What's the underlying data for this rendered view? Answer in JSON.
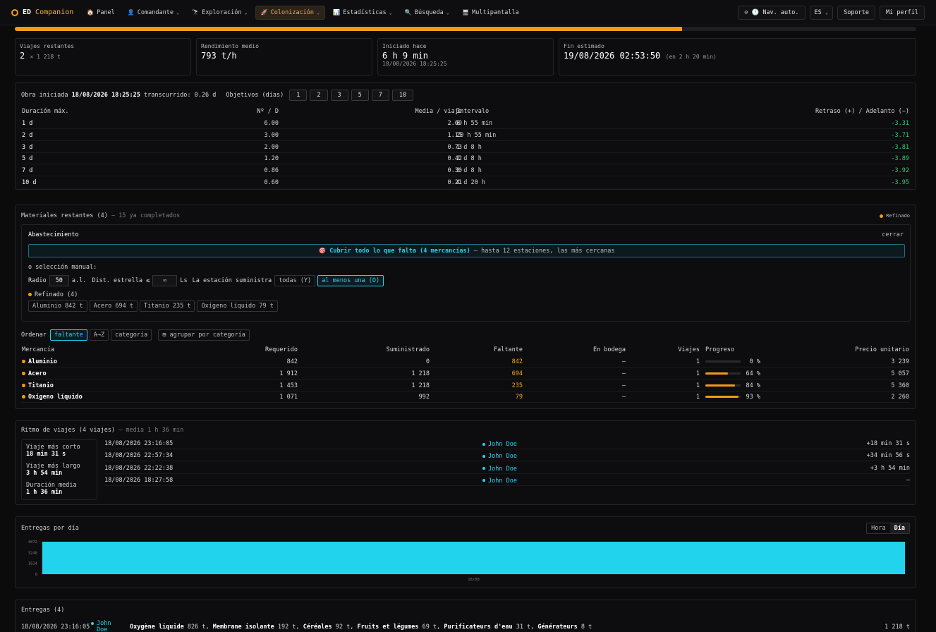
{
  "brand": {
    "a": "ED",
    "b": "Companion"
  },
  "nav": [
    {
      "label": "Panel",
      "icon": "🏠",
      "chev": false
    },
    {
      "label": "Comandante",
      "icon": "👤",
      "chev": true
    },
    {
      "label": "Exploración",
      "icon": "🔭",
      "chev": true
    },
    {
      "label": "Colonización",
      "icon": "🚀",
      "chev": true,
      "active": true
    },
    {
      "label": "Estadísticas",
      "icon": "📊",
      "chev": true
    },
    {
      "label": "Búsqueda",
      "icon": "🔍",
      "chev": true
    },
    {
      "label": "Multipantalla",
      "icon": "🖥",
      "chev": false
    }
  ],
  "topright": {
    "nav_auto": "⊙ 🕐 Nav. auto.",
    "lang": "ES",
    "support": "Soporte",
    "profile": "Mi perfil"
  },
  "progress": 0.74,
  "stats": [
    {
      "label": "Viajes restantes",
      "value": "2",
      "sub": "× 1 218 t"
    },
    {
      "label": "Rendimiento medio",
      "value": "793 t/h",
      "sub": ""
    },
    {
      "label": "Iniciado hace",
      "value": "6 h 9 min",
      "sub": "18/08/2026 18:25:25"
    },
    {
      "label": "Fin estimado",
      "value": "19/08/2026 02:53:50",
      "sub": "(en 2 h 20 min)"
    }
  ],
  "obra": {
    "prefix": "Obra iniciada",
    "date": "18/08/2026 18:25:25",
    "elapsed": "transcurrido: 0.26 d",
    "objectives_label": "Objetivos (días)",
    "objectives": [
      "1",
      "2",
      "3",
      "5",
      "7",
      "10"
    ]
  },
  "duration_table": {
    "headers": [
      "Duración máx.",
      "Nº / D",
      "Media / viaje",
      "Intervalo",
      "Retraso (+) / Adelanto (−)"
    ],
    "rows": [
      [
        "1 d",
        "6.00",
        "2.69",
        "8 h 55 min",
        "-3.31"
      ],
      [
        "2 d",
        "3.00",
        "1.15",
        "20 h 55 min",
        "-3.71"
      ],
      [
        "3 d",
        "2.00",
        "0.73",
        "1 d 8 h",
        "-3.81"
      ],
      [
        "5 d",
        "1.20",
        "0.42",
        "2 d 8 h",
        "-3.89"
      ],
      [
        "7 d",
        "0.86",
        "0.30",
        "3 d 8 h",
        "-3.92"
      ],
      [
        "10 d",
        "0.60",
        "0.21",
        "4 d 20 h",
        "-3.95"
      ]
    ]
  },
  "materials": {
    "title": "Materiales restantes (4)",
    "done": "— 15 ya completados",
    "legend": "Refinado",
    "supply": {
      "title": "Abastecimiento",
      "close": "cerrar",
      "cover_icon": "🎯",
      "cover_main": "Cubrir todo lo que falta (4 mercancías)",
      "cover_rest": "— hasta 12 estaciones, las más cercanas",
      "manual": "o selección manual:",
      "radius_label": "Radio",
      "radius": "50",
      "radius_unit": "a.l.",
      "dist_label": "Dist. estrella ≤",
      "dist": "∞",
      "dist_unit": "Ls",
      "station_label": "La estación suministra",
      "opt_all": "todas (Y)",
      "opt_one": "al menos una (O)",
      "group": "Refinado (4)",
      "chips": [
        "Aluminio 842 t",
        "Acero 694 t",
        "Titanio 235 t",
        "Oxígeno líquido 79 t"
      ]
    },
    "sort_label": "Ordenar",
    "sorts": [
      "faltante",
      "A→Z",
      "categoría"
    ],
    "group_btn": "⊞ agrupar por categoría",
    "headers": [
      "Mercancía",
      "Requerido",
      "Suministrado",
      "Faltante",
      "En bodega",
      "Viajes",
      "Progreso",
      "Precio unitario"
    ],
    "rows": [
      {
        "name": "Aluminio",
        "req": "842",
        "sup": "0",
        "miss": "842",
        "hold": "–",
        "trips": "1",
        "pct": 0,
        "pct_label": "0 %",
        "price": "3 239"
      },
      {
        "name": "Acero",
        "req": "1 912",
        "sup": "1 218",
        "miss": "694",
        "hold": "–",
        "trips": "1",
        "pct": 64,
        "pct_label": "64 %",
        "price": "5 057"
      },
      {
        "name": "Titanio",
        "req": "1 453",
        "sup": "1 218",
        "miss": "235",
        "hold": "–",
        "trips": "1",
        "pct": 84,
        "pct_label": "84 %",
        "price": "5 360"
      },
      {
        "name": "Oxígeno líquido",
        "req": "1 071",
        "sup": "992",
        "miss": "79",
        "hold": "–",
        "trips": "1",
        "pct": 93,
        "pct_label": "93 %",
        "price": "2 260"
      }
    ]
  },
  "rhythm": {
    "title": "Ritmo de viajes (4 viajes)",
    "sub": "— media 1 h 36 min",
    "summary": [
      {
        "label": "Viaje más corto",
        "value": "18 min 31 s"
      },
      {
        "label": "Viaje más largo",
        "value": "3 h 54 min"
      },
      {
        "label": "Duración media",
        "value": "1 h 36 min"
      }
    ],
    "trips": [
      {
        "date": "18/08/2026 23:16:05",
        "user": "John Doe",
        "delta": "+18 min 31 s"
      },
      {
        "date": "18/08/2026 22:57:34",
        "user": "John Doe",
        "delta": "+34 min 56 s"
      },
      {
        "date": "18/08/2026 22:22:38",
        "user": "John Doe",
        "delta": "+3 h 54 min"
      },
      {
        "date": "18/08/2026 18:27:58",
        "user": "John Doe",
        "delta": "–"
      }
    ]
  },
  "chart_data": {
    "type": "bar",
    "title": "Entregas por día",
    "categories": [
      "18/08"
    ],
    "values": [
      4872
    ],
    "y_ticks": [
      "4872",
      "3248",
      "1624",
      "0"
    ],
    "ylim": [
      0,
      4872
    ],
    "toggle": [
      "Hora",
      "Día"
    ],
    "selected": "Día"
  },
  "deliveries": {
    "title": "Entregas (4)",
    "first": {
      "date": "18/08/2026 23:16:05",
      "user_a": "John",
      "user_b": "Doe",
      "items": [
        {
          "n": "Oxygène liquide",
          "q": "826 t,"
        },
        {
          "n": "Membrane isolante",
          "q": "192 t,"
        },
        {
          "n": "Céréales",
          "q": "92 t,"
        },
        {
          "n": "Fruits et légumes",
          "q": "69 t,"
        },
        {
          "n": "Purificateurs d'eau",
          "q": "31 t,"
        },
        {
          "n": "Générateurs",
          "q": "8 t"
        }
      ],
      "total": "1 218 t"
    }
  }
}
